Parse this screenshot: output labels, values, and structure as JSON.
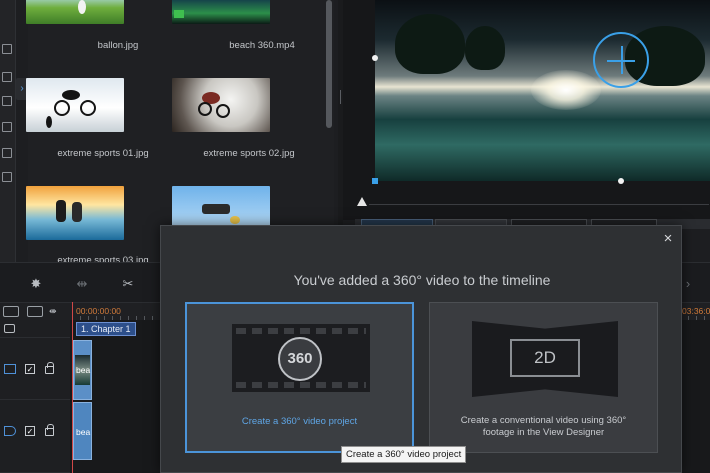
{
  "media_library": {
    "items": [
      {
        "name": "ballon.jpg"
      },
      {
        "name": "beach 360.mp4"
      },
      {
        "name": "extreme sports 01.jpg"
      },
      {
        "name": "extreme sports 02.jpg"
      },
      {
        "name": "extreme sports 03.jpg"
      }
    ],
    "collapse_glyph": "›"
  },
  "timeline": {
    "start_time": "00:00:00:00",
    "end_time": "03:36:0",
    "chapter_marker": "1. Chapter 1",
    "clip_video_label": "bea",
    "clip_audio_label": "bea",
    "check_glyph": "✓"
  },
  "dialog": {
    "title": "You've added a 360° video to the timeline",
    "close_glyph": "×",
    "option_360": {
      "badge": "360",
      "label": "Create a 360° video project"
    },
    "option_2d": {
      "badge": "2D",
      "label": "Create a conventional video using 360° footage in the View Designer"
    },
    "tooltip": "Create a 360° video project"
  },
  "icons": {
    "toolbar": [
      "magic-tool-icon",
      "split-trim-icon",
      "scissors-icon"
    ],
    "ruler": [
      "track-manager-icon",
      "chapter-view-icon",
      "fit-timeline-icon",
      "subtitle-icon"
    ]
  },
  "colors": {
    "accent": "#4b94d9",
    "timecode": "#d27b3a",
    "playhead": "#d04848",
    "clip": "#5b8fc7"
  }
}
